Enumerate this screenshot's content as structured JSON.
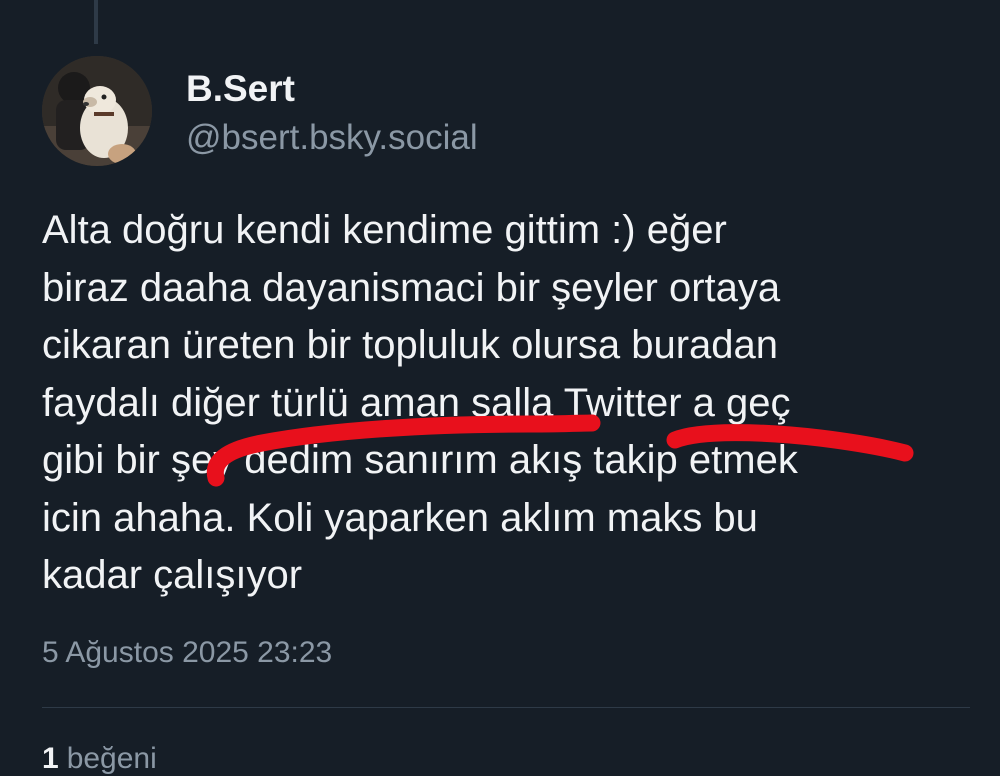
{
  "post": {
    "author": {
      "display_name": "B.Sert",
      "handle": "@bsert.bsky.social"
    },
    "text_lines": [
      "Alta doğru kendi kendime gittim :) eğer",
      "biraz daaha dayanismaci bir şeyler ortaya",
      "cikaran üreten bir topluluk olursa buradan",
      "faydalı diğer türlü aman salla Twitter a geç",
      "gibi bir şey dedim sanırım akış takip etmek",
      "icin ahaha. Koli yaparken aklım maks bu",
      "kadar çalışıyor"
    ],
    "timestamp": "5 Ağustos 2025 23:23",
    "likes": {
      "count": "1",
      "label": "beğeni"
    }
  },
  "colors": {
    "background": "#161e27",
    "text_primary": "#f1f3f5",
    "text_secondary": "#8b98a5",
    "divider": "#2e3a47",
    "scribble": "#e8101c"
  }
}
